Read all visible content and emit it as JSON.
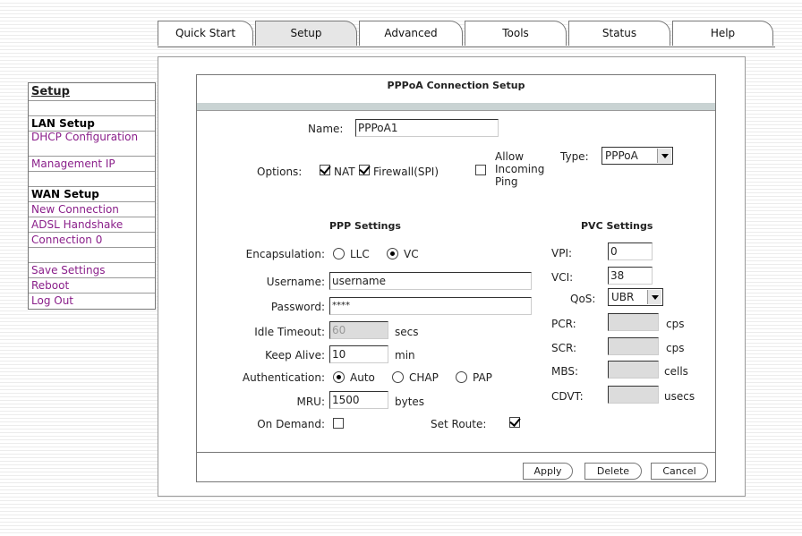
{
  "tabs": {
    "quick_start": "Quick Start",
    "setup": "Setup",
    "advanced": "Advanced",
    "tools": "Tools",
    "status": "Status",
    "help": "Help"
  },
  "sidebar": {
    "title": "Setup",
    "lan_header": "LAN Setup",
    "dhcp": "DHCP Configuration",
    "management_ip": "Management IP",
    "wan_header": "WAN Setup",
    "new_connection": "New Connection",
    "adsl_handshake": "ADSL Handshake",
    "connection0": "Connection 0",
    "save_settings": "Save Settings",
    "reboot": "Reboot",
    "log_out": "Log Out"
  },
  "panel": {
    "title": "PPPoA Connection Setup",
    "name_label": "Name:",
    "name_value": "PPPoA1",
    "options_label": "Options:",
    "nat_label": "NAT",
    "firewall_label": "Firewall(SPI)",
    "ping_label": "Allow Incoming Ping",
    "type_label": "Type:",
    "type_value": "PPPoA",
    "options": {
      "nat": true,
      "firewall": true,
      "ping": false
    }
  },
  "ppp": {
    "section_title": "PPP Settings",
    "encap_label": "Encapsulation:",
    "encap_llc": "LLC",
    "encap_vc": "VC",
    "encap_selected": "VC",
    "username_label": "Username:",
    "username_value": "username",
    "password_label": "Password:",
    "password_value": "****",
    "idle_label": "Idle Timeout:",
    "idle_value": "60",
    "idle_unit": "secs",
    "keepalive_label": "Keep Alive:",
    "keepalive_value": "10",
    "keepalive_unit": "min",
    "auth_label": "Authentication:",
    "auth_auto": "Auto",
    "auth_chap": "CHAP",
    "auth_pap": "PAP",
    "auth_selected": "Auto",
    "mru_label": "MRU:",
    "mru_value": "1500",
    "mru_unit": "bytes",
    "ondemand_label": "On Demand:",
    "ondemand_checked": false,
    "setroute_label": "Set Route:",
    "setroute_checked": true
  },
  "pvc": {
    "section_title": "PVC Settings",
    "vpi_label": "VPI:",
    "vpi_value": "0",
    "vci_label": "VCI:",
    "vci_value": "38",
    "qos_label": "QoS:",
    "qos_value": "UBR",
    "pcr_label": "PCR:",
    "pcr_unit": "cps",
    "scr_label": "SCR:",
    "scr_unit": "cps",
    "mbs_label": "MBS:",
    "mbs_unit": "cells",
    "cdvt_label": "CDVT:",
    "cdvt_unit": "usecs"
  },
  "buttons": {
    "apply": "Apply",
    "delete": "Delete",
    "cancel": "Cancel"
  }
}
